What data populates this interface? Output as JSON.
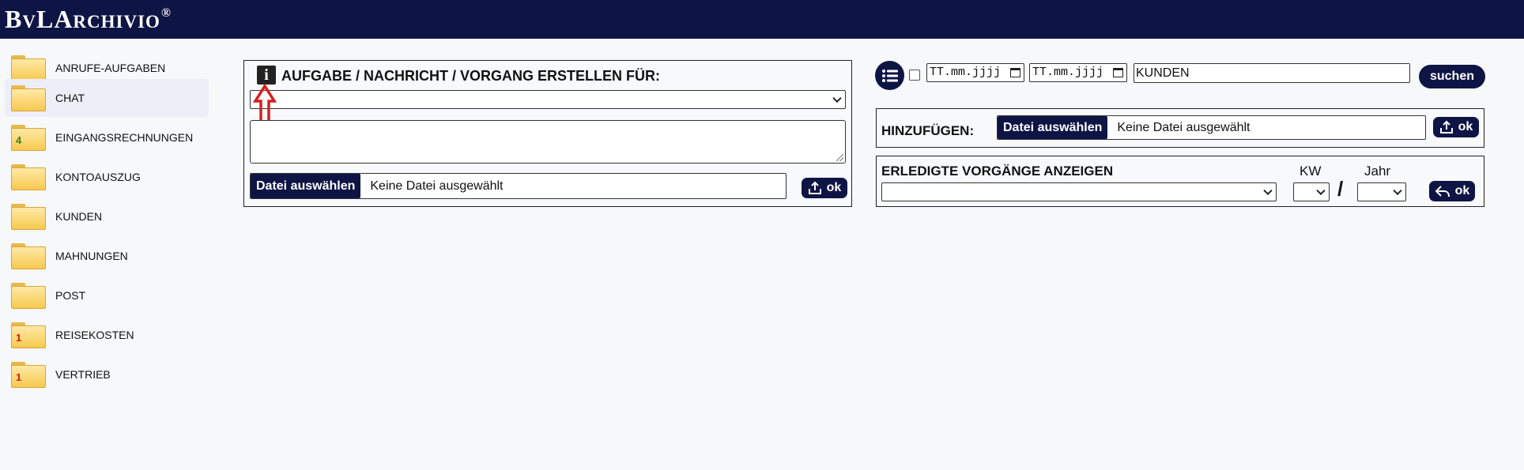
{
  "app": {
    "logo_b": "B",
    "logo_v": "V",
    "logo_la": "LA",
    "logo_rchivio": "RCHIVIO",
    "logo_reg": "®"
  },
  "sidebar": {
    "items": [
      {
        "label": "ANRUFE-AUFGABEN",
        "badge": ""
      },
      {
        "label": "CHAT",
        "badge": ""
      },
      {
        "label": "EINGANGSRECHNUNGEN",
        "badge": "4"
      },
      {
        "label": "KONTOAUSZUG",
        "badge": ""
      },
      {
        "label": "KUNDEN",
        "badge": ""
      },
      {
        "label": "MAHNUNGEN",
        "badge": ""
      },
      {
        "label": "POST",
        "badge": ""
      },
      {
        "label": "REISEKOSTEN",
        "badge": "1"
      },
      {
        "label": "VERTRIEB",
        "badge": "1"
      }
    ]
  },
  "create_panel": {
    "info_glyph": "i",
    "title": "AUFGABE / NACHRICHT / VORGANG ERSTELLEN FÜR:",
    "recipient_value": "",
    "message_value": "",
    "file_button": "Datei auswählen",
    "file_status": "Keine Datei ausgewählt",
    "ok_label": "ok"
  },
  "search": {
    "date_from_placeholder": "TT.mm.jjjj",
    "date_to_placeholder": "TT.mm.jjjj",
    "query_value": "KUNDEN",
    "button_label": "suchen"
  },
  "add_panel": {
    "title": "HINZUFÜGEN:",
    "file_button": "Datei auswählen",
    "file_status": "Keine Datei ausgewählt",
    "ok_label": "ok"
  },
  "done_panel": {
    "title": "ERLEDIGTE VORGÄNGE ANZEIGEN",
    "kw_label": "KW",
    "year_label": "Jahr",
    "separator": "/",
    "ok_label": "ok"
  },
  "colors": {
    "brand": "#0e1545",
    "badge_green": "#3f7f1a",
    "badge_red": "#c81e12",
    "annotation_red": "#d42020"
  }
}
